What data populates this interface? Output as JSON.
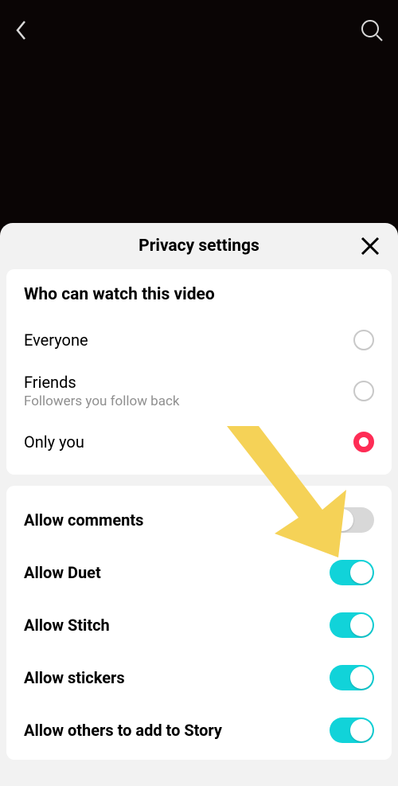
{
  "sheet": {
    "title": "Privacy settings"
  },
  "visibility": {
    "section_title": "Who can watch this video",
    "options": [
      {
        "label": "Everyone",
        "sub": "",
        "selected": false
      },
      {
        "label": "Friends",
        "sub": "Followers you follow back",
        "selected": false
      },
      {
        "label": "Only you",
        "sub": "",
        "selected": true
      }
    ]
  },
  "toggles": {
    "allow_comments": {
      "label": "Allow comments",
      "on": false
    },
    "allow_duet": {
      "label": "Allow Duet",
      "on": true
    },
    "allow_stitch": {
      "label": "Allow Stitch",
      "on": true
    },
    "allow_stickers": {
      "label": "Allow stickers",
      "on": true
    },
    "allow_story": {
      "label": "Allow others to add to Story",
      "on": true
    }
  },
  "colors": {
    "accent_red": "#fe2c55",
    "accent_teal": "#11d3d9",
    "arrow": "#f5d257"
  }
}
